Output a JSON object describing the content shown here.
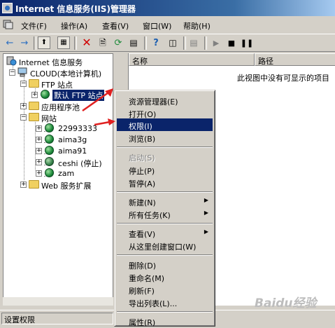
{
  "window": {
    "title": "Internet 信息服务(IIS)管理器"
  },
  "menubar": [
    "文件(F)",
    "操作(A)",
    "查看(V)",
    "窗口(W)",
    "帮助(H)"
  ],
  "tree": {
    "root": "Internet 信息服务",
    "computer": "CLOUD(本地计算机)",
    "ftp_sites": "FTP 站点",
    "default_ftp": "默认 FTP 站点",
    "app_pools": "应用程序池",
    "websites": "网站",
    "sites": [
      "22993333",
      "aima3g",
      "aima91",
      "ceshi (停止)",
      "zam"
    ],
    "web_ext": "Web 服务扩展"
  },
  "list": {
    "columns": [
      "名称",
      "路径"
    ],
    "empty_message": "此视图中没有可显示的项目"
  },
  "context_menu": {
    "items": [
      {
        "label": "资源管理器(E)"
      },
      {
        "label": "打开(O)"
      },
      {
        "label": "权限(I)"
      },
      {
        "label": "浏览(B)"
      },
      {
        "label": "启动(S)"
      },
      {
        "label": "停止(P)"
      },
      {
        "label": "暂停(A)"
      },
      {
        "label": "新建(N)"
      },
      {
        "label": "所有任务(K)"
      },
      {
        "label": "查看(V)"
      },
      {
        "label": "从这里创建窗口(W)"
      },
      {
        "label": "删除(D)"
      },
      {
        "label": "重命名(M)"
      },
      {
        "label": "刷新(F)"
      },
      {
        "label": "导出列表(L)..."
      },
      {
        "label": "属性(R)"
      }
    ]
  },
  "status": {
    "text": "设置权限"
  },
  "watermark": "Baidu经验"
}
